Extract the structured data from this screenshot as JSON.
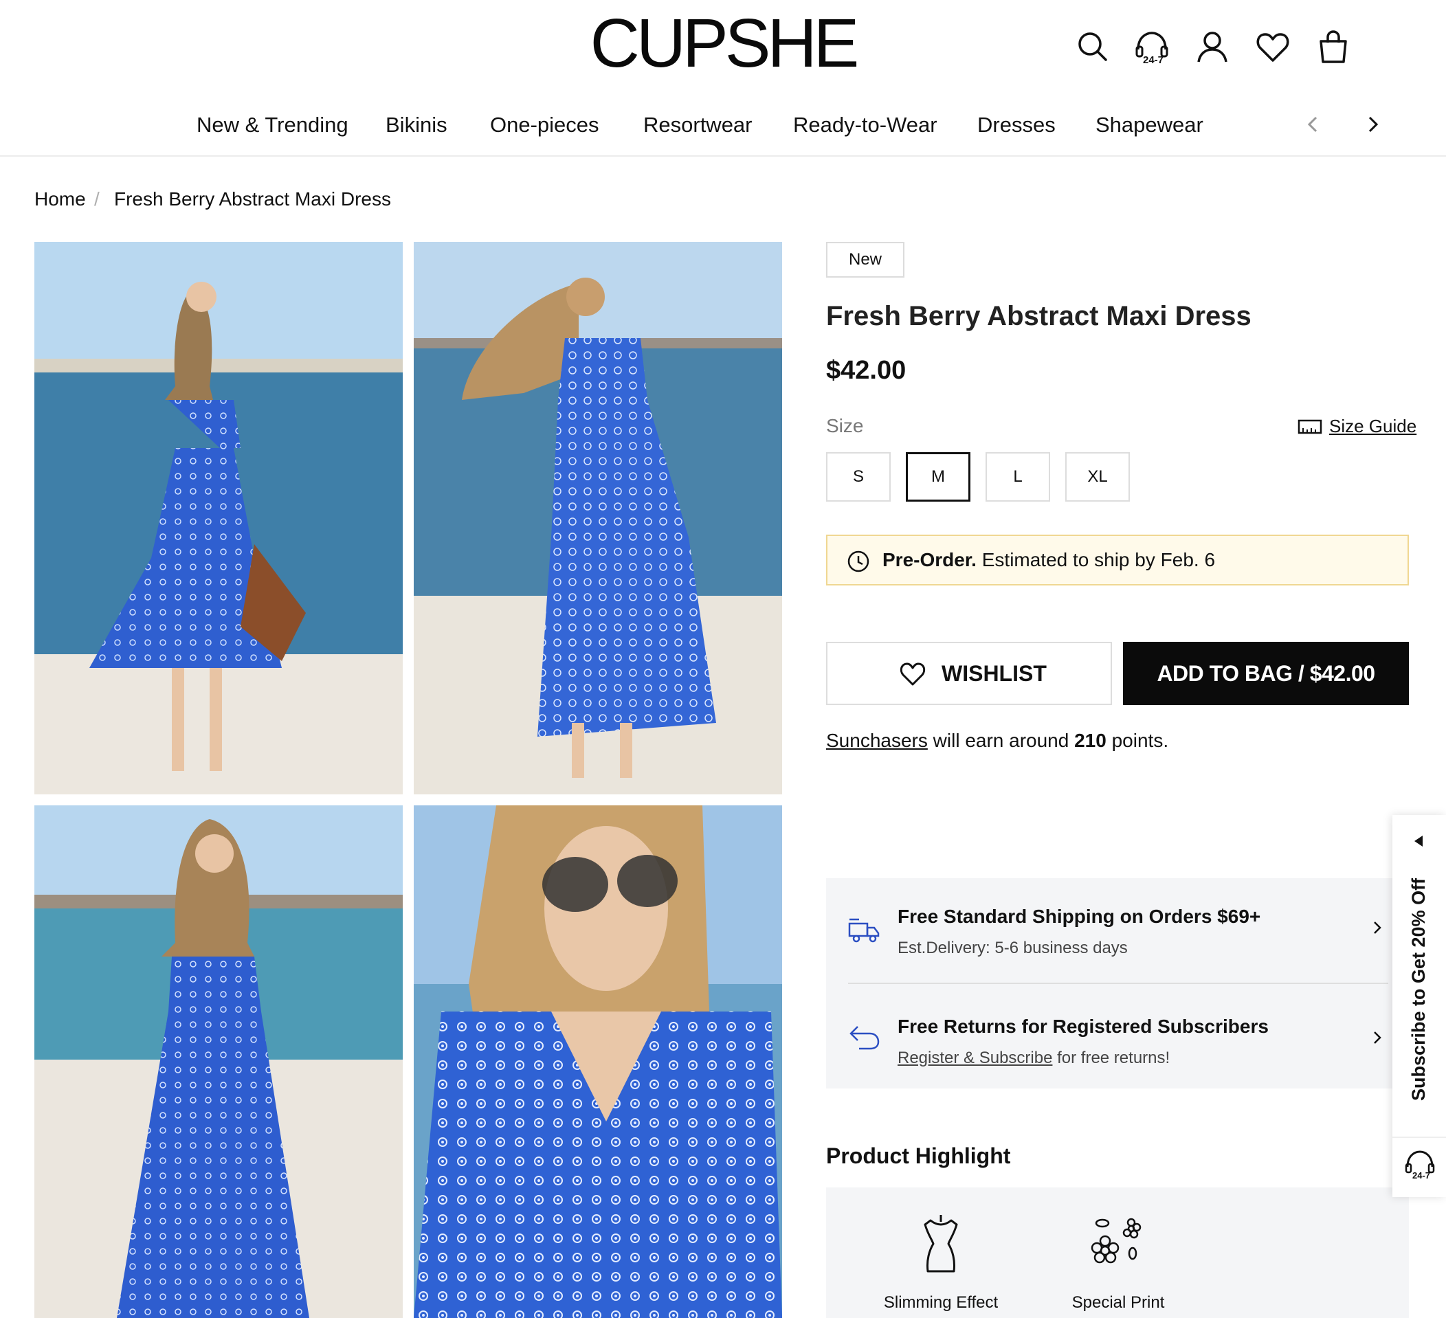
{
  "header": {
    "logo": "CUPSHE",
    "icons": [
      "search-icon",
      "support-24-7-icon",
      "account-icon",
      "wishlist-heart-icon",
      "shopping-bag-icon"
    ],
    "support_badge": "24-7"
  },
  "nav": {
    "items": [
      "New & Trending",
      "Bikinis",
      "One-pieces",
      "Resortwear",
      "Ready-to-Wear",
      "Dresses",
      "Shapewear"
    ],
    "prev_icon": "chevron-left-icon",
    "next_icon": "chevron-right-icon"
  },
  "breadcrumb": {
    "home": "Home",
    "separator": "/",
    "current": "Fresh Berry Abstract Maxi Dress"
  },
  "gallery": {
    "count": 4
  },
  "product": {
    "badge": "New",
    "title": "Fresh Berry Abstract Maxi Dress",
    "price": "$42.00",
    "size_label": "Size",
    "size_guide": "Size Guide",
    "sizes": [
      "S",
      "M",
      "L",
      "XL"
    ],
    "selected_size": "M",
    "preorder": {
      "label": "Pre-Order.",
      "text": "Estimated to ship by",
      "date": "Feb. 6"
    },
    "wishlist_label": "WISHLIST",
    "add_to_bag_label": "ADD TO BAG / $42.00",
    "points": {
      "link": "Sunchasers",
      "text_before": "will earn around",
      "value": "210",
      "text_after": "points."
    }
  },
  "perks": [
    {
      "icon": "delivery-truck-icon",
      "title": "Free Standard Shipping on Orders $69+",
      "subtitle": "Est.Delivery: 5-6 business days"
    },
    {
      "icon": "return-arrow-icon",
      "title": "Free Returns for Registered Subscribers",
      "subtitle_link": "Register & Subscribe",
      "subtitle_rest": "for free returns!"
    }
  ],
  "highlights": {
    "title": "Product Highlight",
    "items": [
      {
        "icon": "dress-form-icon",
        "label": "Slimming Effect"
      },
      {
        "icon": "flowers-icon",
        "label": "Special Print"
      }
    ]
  },
  "side_tab": {
    "text": "Subscribe to Get 20% Off",
    "support_badge": "24-7"
  },
  "colors": {
    "accent_black": "#0b0b0b",
    "preorder_bg": "#fffaea",
    "preorder_border": "#f0d792",
    "panel_bg": "#f4f5f7",
    "dress_blue": "#2f5fd0"
  }
}
